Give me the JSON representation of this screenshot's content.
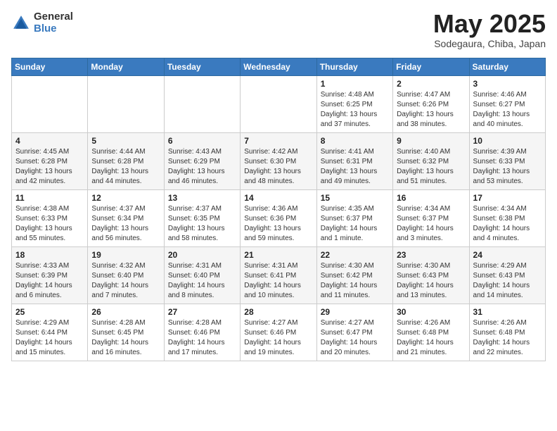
{
  "logo": {
    "general": "General",
    "blue": "Blue"
  },
  "title": {
    "month_year": "May 2025",
    "location": "Sodegaura, Chiba, Japan"
  },
  "days_of_week": [
    "Sunday",
    "Monday",
    "Tuesday",
    "Wednesday",
    "Thursday",
    "Friday",
    "Saturday"
  ],
  "weeks": [
    [
      {
        "day": "",
        "info": ""
      },
      {
        "day": "",
        "info": ""
      },
      {
        "day": "",
        "info": ""
      },
      {
        "day": "",
        "info": ""
      },
      {
        "day": "1",
        "info": "Sunrise: 4:48 AM\nSunset: 6:25 PM\nDaylight: 13 hours and 37 minutes."
      },
      {
        "day": "2",
        "info": "Sunrise: 4:47 AM\nSunset: 6:26 PM\nDaylight: 13 hours and 38 minutes."
      },
      {
        "day": "3",
        "info": "Sunrise: 4:46 AM\nSunset: 6:27 PM\nDaylight: 13 hours and 40 minutes."
      }
    ],
    [
      {
        "day": "4",
        "info": "Sunrise: 4:45 AM\nSunset: 6:28 PM\nDaylight: 13 hours and 42 minutes."
      },
      {
        "day": "5",
        "info": "Sunrise: 4:44 AM\nSunset: 6:28 PM\nDaylight: 13 hours and 44 minutes."
      },
      {
        "day": "6",
        "info": "Sunrise: 4:43 AM\nSunset: 6:29 PM\nDaylight: 13 hours and 46 minutes."
      },
      {
        "day": "7",
        "info": "Sunrise: 4:42 AM\nSunset: 6:30 PM\nDaylight: 13 hours and 48 minutes."
      },
      {
        "day": "8",
        "info": "Sunrise: 4:41 AM\nSunset: 6:31 PM\nDaylight: 13 hours and 49 minutes."
      },
      {
        "day": "9",
        "info": "Sunrise: 4:40 AM\nSunset: 6:32 PM\nDaylight: 13 hours and 51 minutes."
      },
      {
        "day": "10",
        "info": "Sunrise: 4:39 AM\nSunset: 6:33 PM\nDaylight: 13 hours and 53 minutes."
      }
    ],
    [
      {
        "day": "11",
        "info": "Sunrise: 4:38 AM\nSunset: 6:33 PM\nDaylight: 13 hours and 55 minutes."
      },
      {
        "day": "12",
        "info": "Sunrise: 4:37 AM\nSunset: 6:34 PM\nDaylight: 13 hours and 56 minutes."
      },
      {
        "day": "13",
        "info": "Sunrise: 4:37 AM\nSunset: 6:35 PM\nDaylight: 13 hours and 58 minutes."
      },
      {
        "day": "14",
        "info": "Sunrise: 4:36 AM\nSunset: 6:36 PM\nDaylight: 13 hours and 59 minutes."
      },
      {
        "day": "15",
        "info": "Sunrise: 4:35 AM\nSunset: 6:37 PM\nDaylight: 14 hours and 1 minute."
      },
      {
        "day": "16",
        "info": "Sunrise: 4:34 AM\nSunset: 6:37 PM\nDaylight: 14 hours and 3 minutes."
      },
      {
        "day": "17",
        "info": "Sunrise: 4:34 AM\nSunset: 6:38 PM\nDaylight: 14 hours and 4 minutes."
      }
    ],
    [
      {
        "day": "18",
        "info": "Sunrise: 4:33 AM\nSunset: 6:39 PM\nDaylight: 14 hours and 6 minutes."
      },
      {
        "day": "19",
        "info": "Sunrise: 4:32 AM\nSunset: 6:40 PM\nDaylight: 14 hours and 7 minutes."
      },
      {
        "day": "20",
        "info": "Sunrise: 4:31 AM\nSunset: 6:40 PM\nDaylight: 14 hours and 8 minutes."
      },
      {
        "day": "21",
        "info": "Sunrise: 4:31 AM\nSunset: 6:41 PM\nDaylight: 14 hours and 10 minutes."
      },
      {
        "day": "22",
        "info": "Sunrise: 4:30 AM\nSunset: 6:42 PM\nDaylight: 14 hours and 11 minutes."
      },
      {
        "day": "23",
        "info": "Sunrise: 4:30 AM\nSunset: 6:43 PM\nDaylight: 14 hours and 13 minutes."
      },
      {
        "day": "24",
        "info": "Sunrise: 4:29 AM\nSunset: 6:43 PM\nDaylight: 14 hours and 14 minutes."
      }
    ],
    [
      {
        "day": "25",
        "info": "Sunrise: 4:29 AM\nSunset: 6:44 PM\nDaylight: 14 hours and 15 minutes."
      },
      {
        "day": "26",
        "info": "Sunrise: 4:28 AM\nSunset: 6:45 PM\nDaylight: 14 hours and 16 minutes."
      },
      {
        "day": "27",
        "info": "Sunrise: 4:28 AM\nSunset: 6:46 PM\nDaylight: 14 hours and 17 minutes."
      },
      {
        "day": "28",
        "info": "Sunrise: 4:27 AM\nSunset: 6:46 PM\nDaylight: 14 hours and 19 minutes."
      },
      {
        "day": "29",
        "info": "Sunrise: 4:27 AM\nSunset: 6:47 PM\nDaylight: 14 hours and 20 minutes."
      },
      {
        "day": "30",
        "info": "Sunrise: 4:26 AM\nSunset: 6:48 PM\nDaylight: 14 hours and 21 minutes."
      },
      {
        "day": "31",
        "info": "Sunrise: 4:26 AM\nSunset: 6:48 PM\nDaylight: 14 hours and 22 minutes."
      }
    ]
  ]
}
